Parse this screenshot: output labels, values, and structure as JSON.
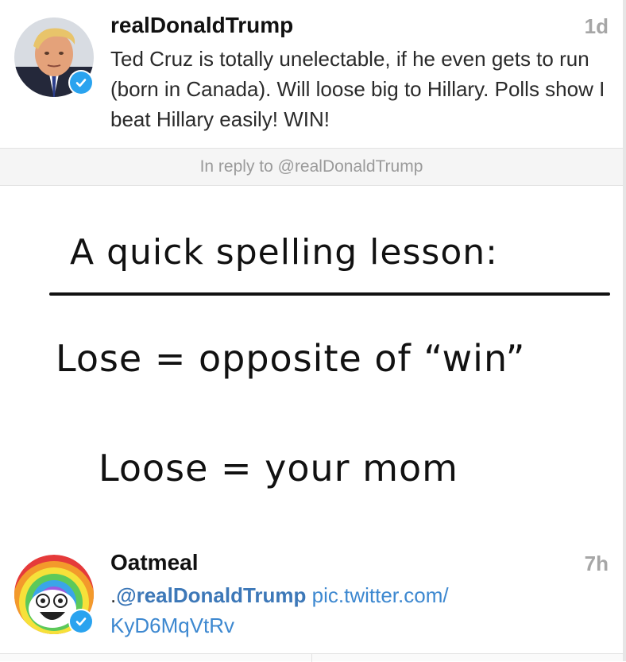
{
  "tweets": [
    {
      "username": "realDonaldTrump",
      "timestamp": "1d",
      "text": "Ted Cruz is totally unelectable, if he even gets to run (born in Canada). Will loose big to Hillary. Polls show I beat Hillary easily! WIN!",
      "avatar_icon": "user-avatar-icon",
      "verified": true
    },
    {
      "username": "Oatmeal",
      "timestamp": "7h",
      "text_prefix": ".",
      "mention": "@realDonaldTrump",
      "link_line1": "pic.twitter.com/",
      "link_line2": "KyD6MqVtRv",
      "avatar_icon": "user-avatar-icon",
      "verified": true
    }
  ],
  "reply_context": "In reply to @realDonaldTrump",
  "comic": {
    "title": "A quick spelling lesson:",
    "line1": "Lose = opposite of “win”",
    "line2": "Loose = your mom"
  },
  "colors": {
    "verified": "#2aa3ef",
    "mention": "#3d78b8",
    "link": "#3d88d0",
    "timestamp": "#a6a6a6"
  }
}
